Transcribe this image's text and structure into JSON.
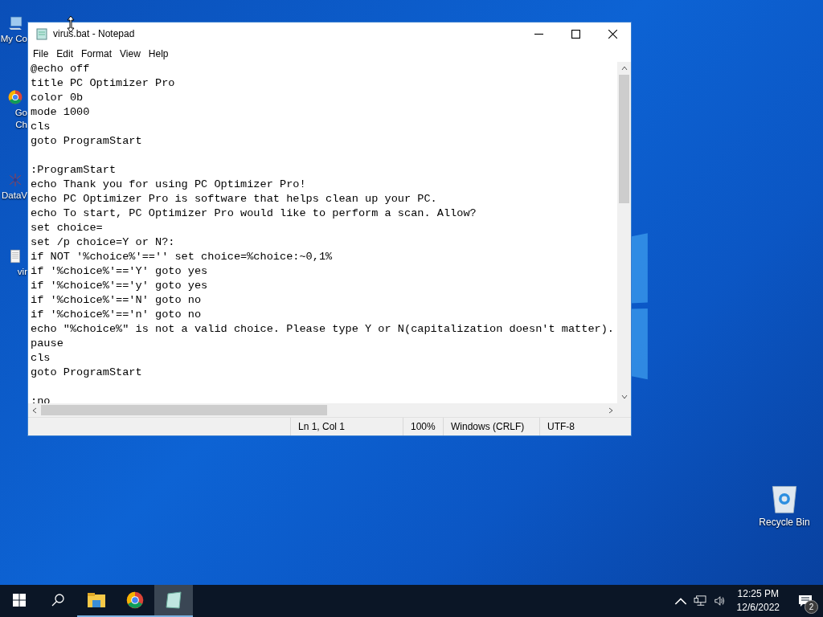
{
  "desktop_icons": [
    {
      "kind": "computer",
      "label_lines": [
        "My Co"
      ]
    },
    {
      "kind": "chrome",
      "label_lines": [
        "Go",
        "Ch"
      ]
    },
    {
      "kind": "app",
      "label_lines": [
        "DataV"
      ]
    },
    {
      "kind": "file",
      "label_lines": [
        "vir"
      ]
    },
    {
      "kind": "recycle",
      "label_lines": [
        "Recycle Bin"
      ]
    }
  ],
  "window": {
    "title": "virus.bat - Notepad",
    "menu": [
      "File",
      "Edit",
      "Format",
      "View",
      "Help"
    ],
    "blocks": [
      [
        "@echo off",
        "title PC Optimizer Pro",
        "color 0b",
        "mode 1000",
        "cls",
        "goto ProgramStart"
      ],
      [
        ":ProgramStart",
        "echo Thank you for using PC Optimizer Pro!",
        "echo PC Optimizer Pro is software that helps clean up your PC.",
        "echo To start, PC Optimizer Pro would like to perform a scan. Allow?",
        "set choice=",
        "set /p choice=Y or N?:",
        "if NOT '%choice%'=='' set choice=%choice:~0,1%",
        "if '%choice%'=='Y' goto yes",
        "if '%choice%'=='y' goto yes",
        "if '%choice%'=='N' goto no",
        "if '%choice%'=='n' goto no",
        "echo \"%choice%\" is not a valid choice. Please type Y or N(capitalization doesn't matter).",
        "pause",
        "cls",
        "goto ProgramStart"
      ],
      [
        ":no"
      ]
    ],
    "status": [
      "Ln 1, Col 1",
      "100%",
      "Windows (CRLF)",
      "UTF-8"
    ]
  },
  "taskbar": {
    "apps": [
      {
        "kind": "start",
        "active": false
      },
      {
        "kind": "search",
        "active": false
      },
      {
        "kind": "explorer",
        "active": false
      },
      {
        "kind": "chrome",
        "active": false
      },
      {
        "kind": "notepad",
        "active": true
      }
    ],
    "time": "12:25 PM",
    "date": "12/6/2022",
    "notification_count": "2"
  }
}
